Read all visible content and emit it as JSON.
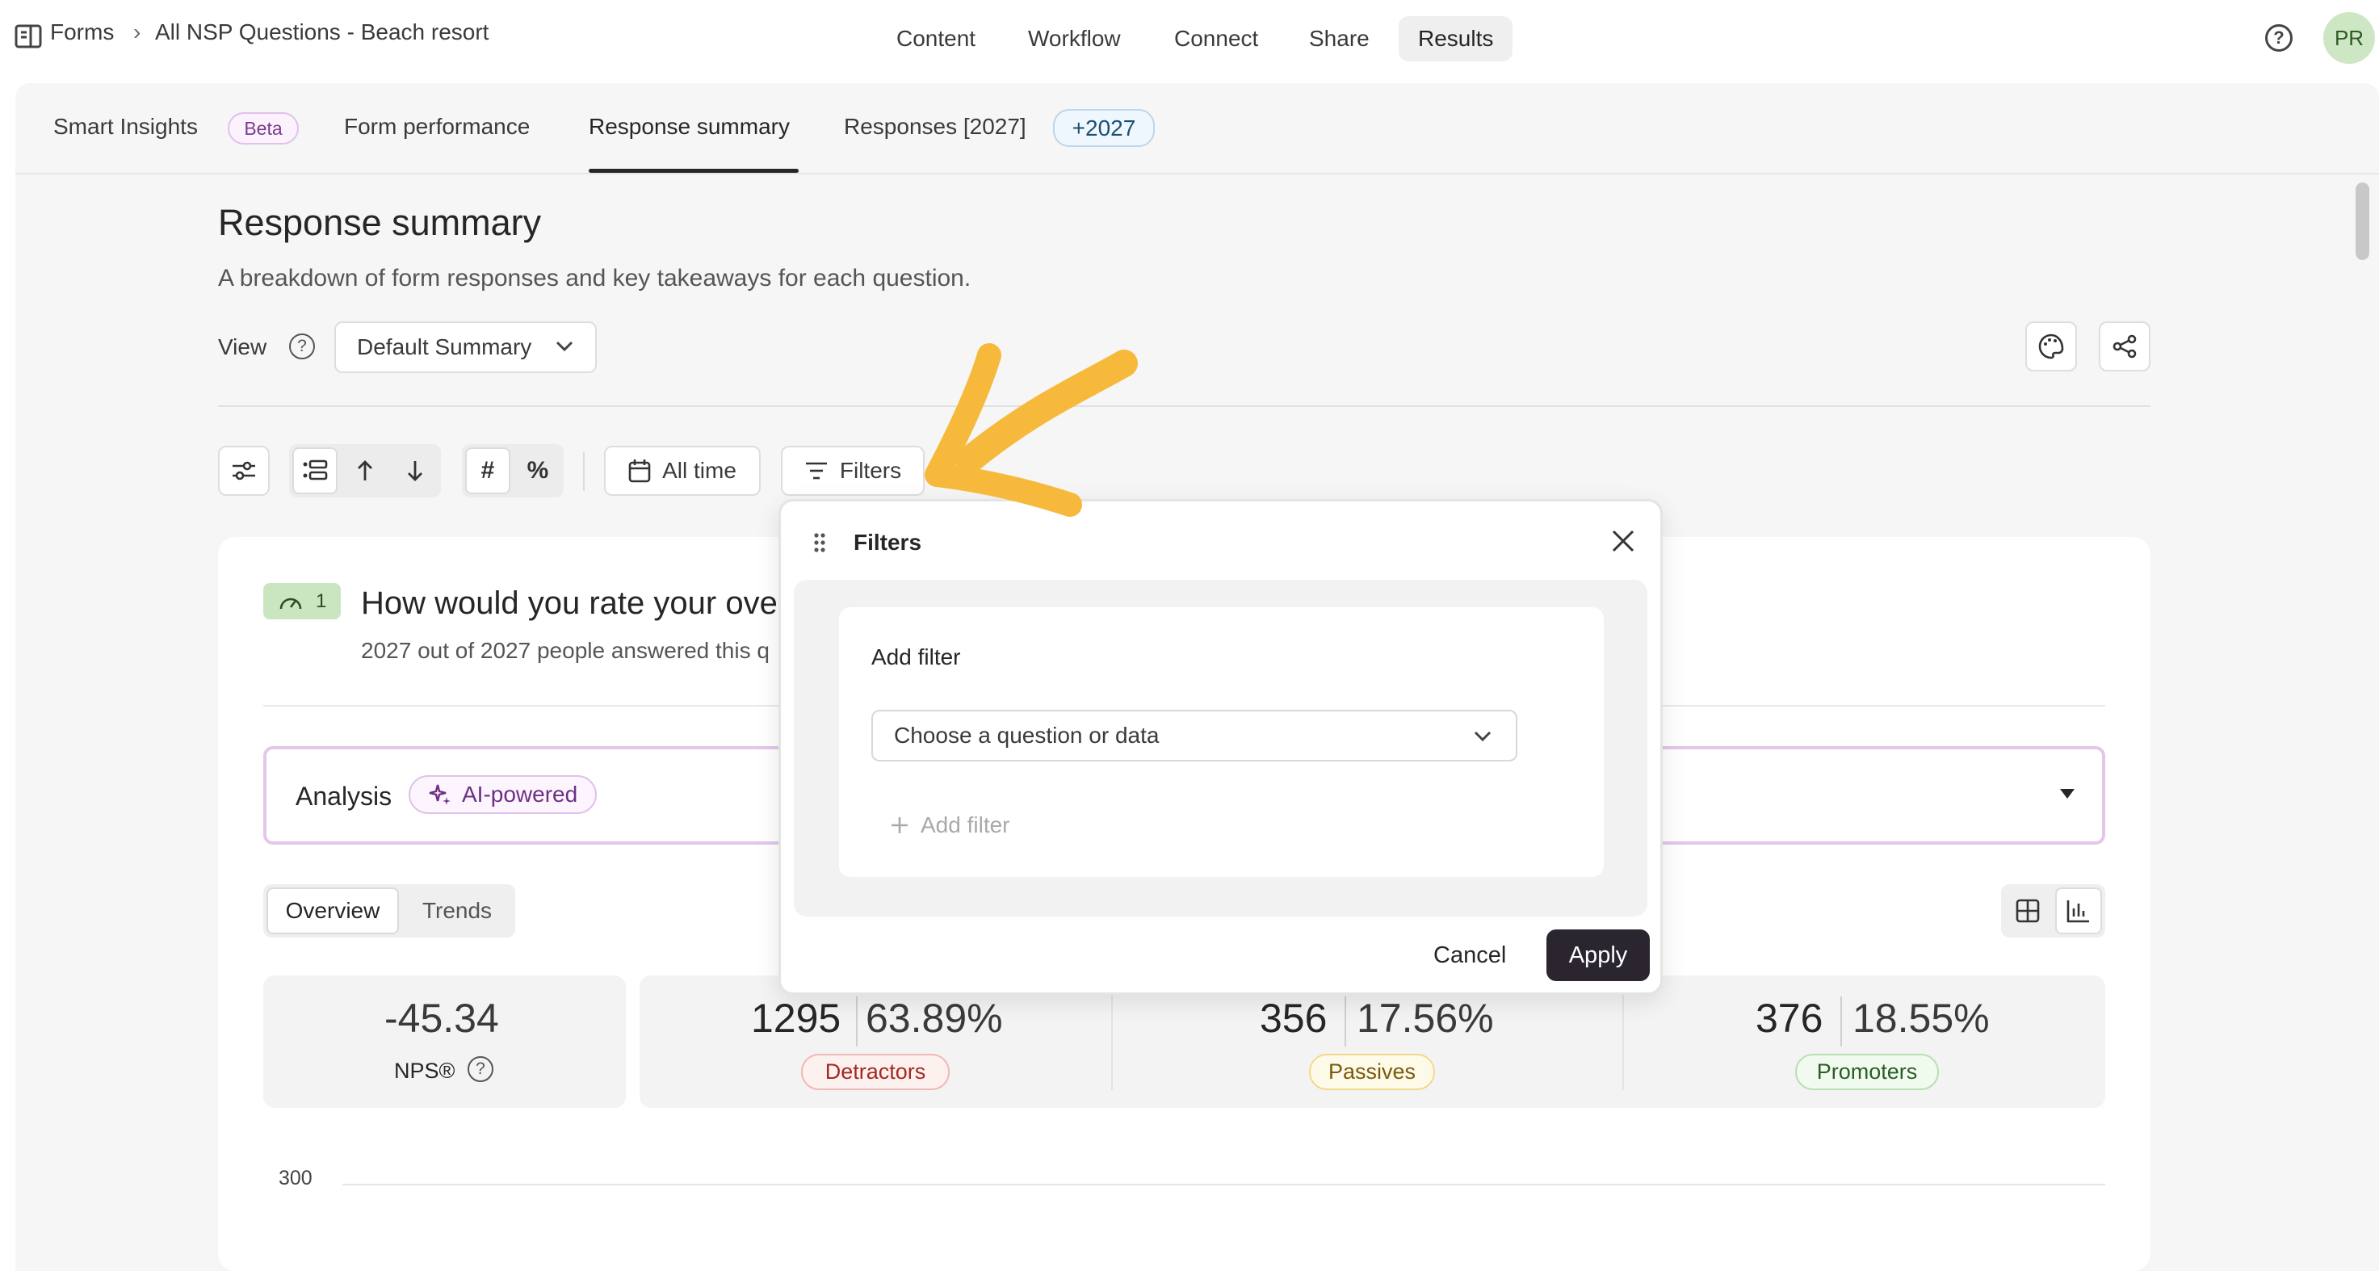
{
  "breadcrumb": {
    "root": "Forms",
    "separator": "›",
    "current": "All NSP Questions - Beach resort"
  },
  "top_nav": [
    "Content",
    "Workflow",
    "Connect",
    "Share",
    "Results"
  ],
  "active_nav": "Results",
  "avatar_initials": "PR",
  "tabs": [
    {
      "label": "Smart Insights",
      "badge": "Beta"
    },
    {
      "label": "Form performance"
    },
    {
      "label": "Response summary"
    },
    {
      "label": "Responses [2027]",
      "badge": "+2027"
    }
  ],
  "active_tab": "Response summary",
  "page": {
    "title": "Response summary",
    "subtitle": "A breakdown of form responses and key takeaways for each question.",
    "view_label": "View",
    "view_select": "Default Summary"
  },
  "toolbar": {
    "date_range": "All time",
    "filters_label": "Filters"
  },
  "question": {
    "number": "1",
    "title": "How would you rate your ove",
    "answered": "2027 out of 2027 people answered this q"
  },
  "analysis": {
    "label": "Analysis",
    "badge": "AI-powered"
  },
  "view_toggle": {
    "overview": "Overview",
    "trends": "Trends"
  },
  "stats": {
    "nps_value": "-45.34",
    "nps_label": "NPS®",
    "detractors": {
      "count": "1295",
      "percent": "63.89%",
      "label": "Detractors"
    },
    "passives": {
      "count": "356",
      "percent": "17.56%",
      "label": "Passives"
    },
    "promoters": {
      "count": "376",
      "percent": "18.55%",
      "label": "Promoters"
    }
  },
  "chart_axis_label": "300",
  "filters_modal": {
    "title": "Filters",
    "add_filter_heading": "Add filter",
    "select_placeholder": "Choose a question or data",
    "add_filter_link": "Add filter",
    "cancel": "Cancel",
    "apply": "Apply"
  },
  "colors": {
    "accent_dark": "#2b2530",
    "arrow": "#f6b93b",
    "detractor": "#c0392b",
    "passive": "#8a6a10",
    "promoter": "#2e6b2c",
    "analysis_border": "#e3c6ec"
  }
}
